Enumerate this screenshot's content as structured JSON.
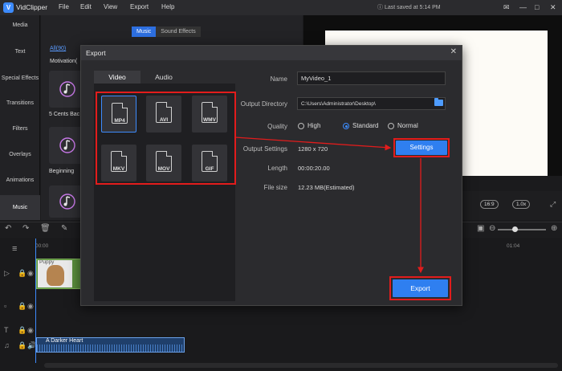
{
  "titlebar": {
    "app_name": "VidClipper",
    "menu": [
      "File",
      "Edit",
      "View",
      "Export",
      "Help"
    ],
    "saved_status": "Last saved at 5:14 PM",
    "window_controls": [
      "minimize-icon",
      "maximize-icon",
      "close-icon"
    ]
  },
  "sidebar": {
    "items": [
      "Media",
      "Text",
      "Special Effects",
      "Transitions",
      "Filters",
      "Overlays",
      "Animations",
      "Music"
    ],
    "active": "Music"
  },
  "media_panel": {
    "tabs": [
      "Music",
      "Sound Effects"
    ],
    "active_tab": "Music",
    "all_link": "All(90)",
    "category": "Motivation(",
    "tracks": [
      "5 Cents Bac",
      "Beginning"
    ]
  },
  "preview": {
    "aspect": "16:9",
    "speed": "1.0x"
  },
  "timeline": {
    "timecodes": [
      "00:00",
      "01:04"
    ],
    "video_clip_label": "Puppy",
    "audio_clip_name": "A Darker Heart"
  },
  "dialog": {
    "title": "Export",
    "tabs": [
      "Video",
      "Audio"
    ],
    "active_tab": "Video",
    "formats": [
      "MP4",
      "AVI",
      "WMV",
      "MKV",
      "MOV",
      "GIF"
    ],
    "selected_format": "MP4",
    "fields": {
      "name_label": "Name",
      "name_value": "MyVideo_1",
      "dir_label": "Output Directory",
      "dir_value": "C:\\Users\\Administrator\\Desktop\\",
      "quality_label": "Quality",
      "quality_options": [
        "High",
        "Standard",
        "Normal"
      ],
      "quality_selected": "Standard",
      "settings_label": "Output Settings",
      "settings_value": "1280 x 720",
      "length_label": "Length",
      "length_value": "00:00:20.00",
      "filesize_label": "File size",
      "filesize_value": "12.23 MB(Estimated)"
    },
    "settings_button": "Settings",
    "export_button": "Export"
  },
  "colors": {
    "accent": "#2f7ff0",
    "highlight": "#e21c1c"
  }
}
